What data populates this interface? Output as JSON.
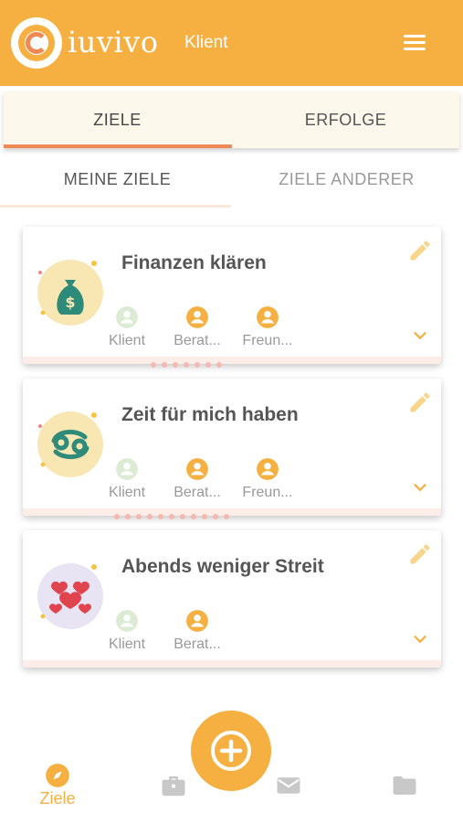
{
  "header": {
    "brand": "iuvivo",
    "role": "Klient",
    "accent_color": "#F5B041"
  },
  "tabs": [
    {
      "label": "ZIELE",
      "active": true
    },
    {
      "label": "ERFOLGE",
      "active": false
    }
  ],
  "subtabs": [
    {
      "label": "MEINE ZIELE",
      "active": true
    },
    {
      "label": "ZIELE ANDERER",
      "active": false
    }
  ],
  "goals": [
    {
      "title": "Finanzen klären",
      "icon": "money-bag-icon",
      "participants": [
        {
          "label": "Klient",
          "state": "inactive"
        },
        {
          "label": "Berat...",
          "state": "active"
        },
        {
          "label": "Freun...",
          "state": "active"
        }
      ]
    },
    {
      "title": "Zeit für mich haben",
      "icon": "cancer-zodiac-icon",
      "participants": [
        {
          "label": "Klient",
          "state": "inactive"
        },
        {
          "label": "Berat...",
          "state": "active"
        },
        {
          "label": "Freun...",
          "state": "active"
        }
      ]
    },
    {
      "title": "Abends weniger Streit",
      "icon": "hearts-icon",
      "participants": [
        {
          "label": "Klient",
          "state": "inactive"
        },
        {
          "label": "Berat...",
          "state": "active"
        }
      ]
    }
  ],
  "bottom_nav": [
    {
      "label": "Ziele",
      "icon": "compass-icon",
      "active": true
    },
    {
      "label": "",
      "icon": "briefcase-icon",
      "active": false
    },
    {
      "label": "",
      "icon": "mail-icon",
      "active": false
    },
    {
      "label": "",
      "icon": "folder-icon",
      "active": false
    }
  ],
  "fab": {
    "icon": "add-icon"
  }
}
